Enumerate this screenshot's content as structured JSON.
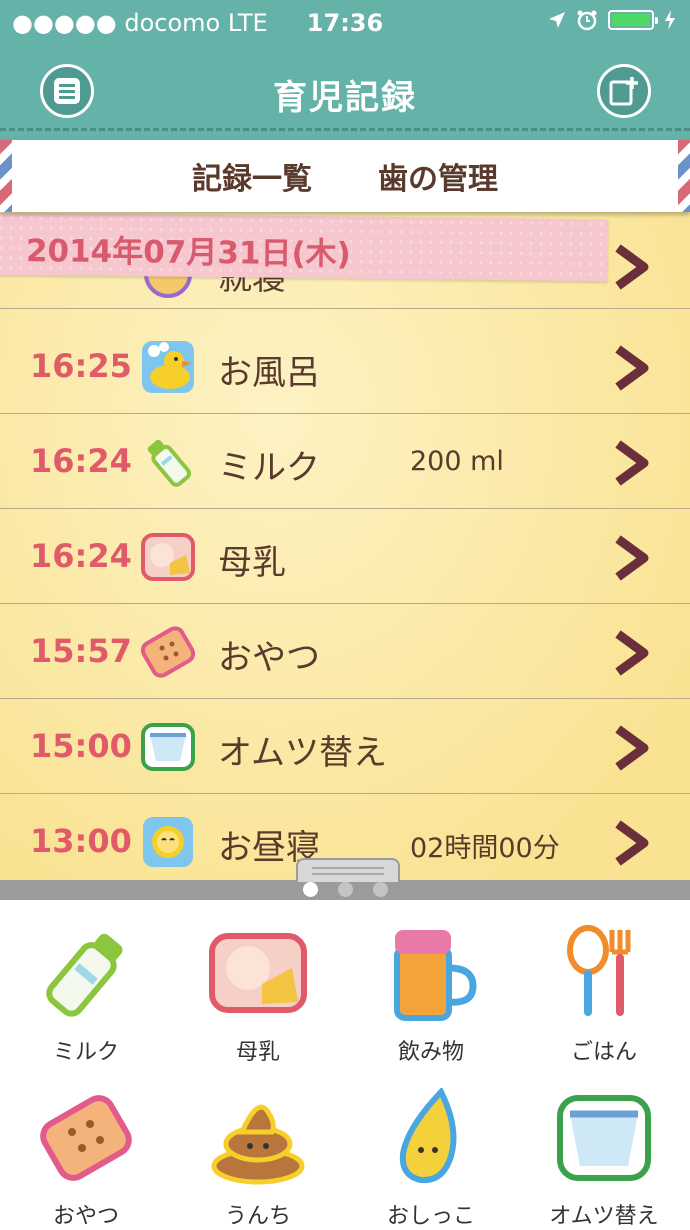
{
  "status_bar": {
    "carrier": "●●●●● docomo  LTE",
    "time": "17:36"
  },
  "header": {
    "title": "育児記録",
    "menu_icon": "menu-icon",
    "add_icon": "add-record-icon"
  },
  "tabs": [
    {
      "label": "記録一覧"
    },
    {
      "label": "歯の管理"
    }
  ],
  "list": {
    "date": "2014年07月31日(木)",
    "partial_row_label": "就寝",
    "rows": [
      {
        "time": "16:25",
        "label": "お風呂",
        "amount": "",
        "icon": "duck-icon"
      },
      {
        "time": "16:24",
        "label": "ミルク",
        "amount": "200 ml",
        "icon": "bottle-icon"
      },
      {
        "time": "16:24",
        "label": "母乳",
        "amount": "",
        "icon": "breastfeed-icon"
      },
      {
        "time": "15:57",
        "label": "おやつ",
        "amount": "",
        "icon": "cookie-icon"
      },
      {
        "time": "15:00",
        "label": "オムツ替え",
        "amount": "",
        "icon": "diaper-icon"
      },
      {
        "time": "13:00",
        "label": "お昼寝",
        "amount": "02時間00分",
        "icon": "sun-icon"
      }
    ]
  },
  "pager": {
    "pages": 3,
    "current": 1
  },
  "panel": {
    "buttons": [
      {
        "label": "ミルク",
        "icon": "bottle-icon"
      },
      {
        "label": "母乳",
        "icon": "breastfeed-icon"
      },
      {
        "label": "飲み物",
        "icon": "drink-icon"
      },
      {
        "label": "ごはん",
        "icon": "spoon-fork-icon"
      },
      {
        "label": "おやつ",
        "icon": "cookie-icon"
      },
      {
        "label": "うんち",
        "icon": "poop-icon"
      },
      {
        "label": "おしっこ",
        "icon": "pee-drop-icon"
      },
      {
        "label": "オムツ替え",
        "icon": "diaper-icon"
      }
    ]
  },
  "colors": {
    "header": "#65b2a9",
    "accent_time": "#e05a6a",
    "text_brown": "#5a3a2c",
    "chevron": "#6b2f3c",
    "tape": "#f6c7cf"
  }
}
